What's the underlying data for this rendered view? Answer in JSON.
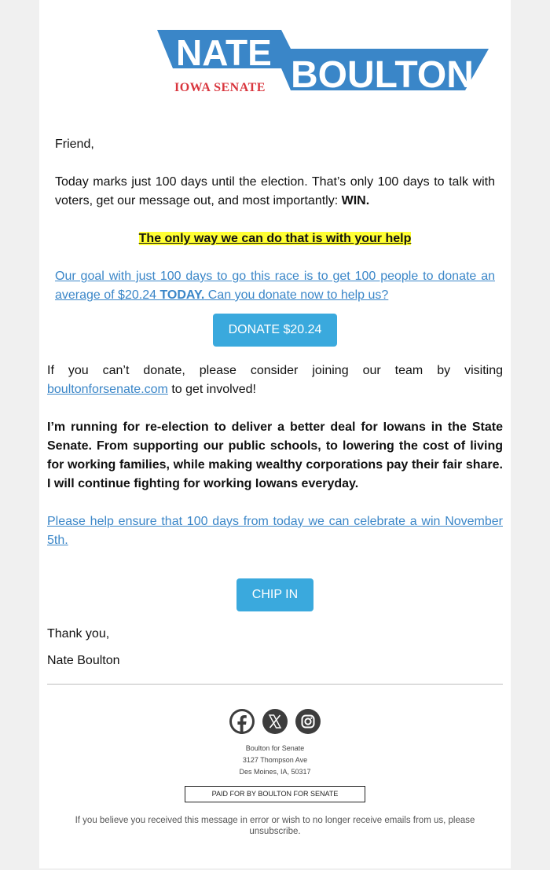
{
  "logo": {
    "first_name": "NATE",
    "last_name": "BOULTON",
    "subtitle": "IOWA SENATE",
    "brand_blue": "#3a86c8",
    "brand_red": "#d9363e"
  },
  "email": {
    "greeting": "Friend,",
    "intro_text": "Today marks just 100 days until the election. That’s only 100 days to talk with voters, get our message out, and most importantly: ",
    "intro_bold": "WIN.",
    "highlight": "The only way we can do that is with your help",
    "goal_link_part1": "Our goal with just 100 days to go this race is to get 100 people to donate an average of $20.24 ",
    "goal_link_bold": "TODAY.",
    "goal_link_part2": " Can you donate now to help us?",
    "donate_button": "DONATE $20.24",
    "join_text_before": "If you can’t donate, please consider joining our team by visiting ",
    "join_link": "boultonforsenate.com",
    "join_text_after": " to get involved!",
    "platform_text": "I’m running for re-election to deliver a better deal for Iowans in the State Senate. From supporting our public schools, to lowering the cost of living for working families, while making wealthy corporations pay their fair share. I will continue fighting for working Iowans everyday.",
    "celebrate_link": "Please help ensure that 100 days from today we can celebrate a win November 5th.",
    "chip_in_button": "CHIP IN",
    "signoff": "Thank you,",
    "signature": "Nate Boulton"
  },
  "footer": {
    "social": [
      {
        "name": "facebook-icon"
      },
      {
        "name": "x-twitter-icon"
      },
      {
        "name": "instagram-icon"
      }
    ],
    "org_name": "Boulton for Senate",
    "street": "3127 Thompson Ave",
    "city_state_zip": "Des Moines, IA, 50317",
    "paid_for": "PAID FOR BY BOULTON FOR SENATE",
    "unsubscribe_text": "If you believe you received this message in error or wish to no longer receive emails from us, please unsubscribe."
  },
  "colors": {
    "button": "#3aa9dd",
    "link": "#3a86c8",
    "highlight": "#ffff33"
  }
}
